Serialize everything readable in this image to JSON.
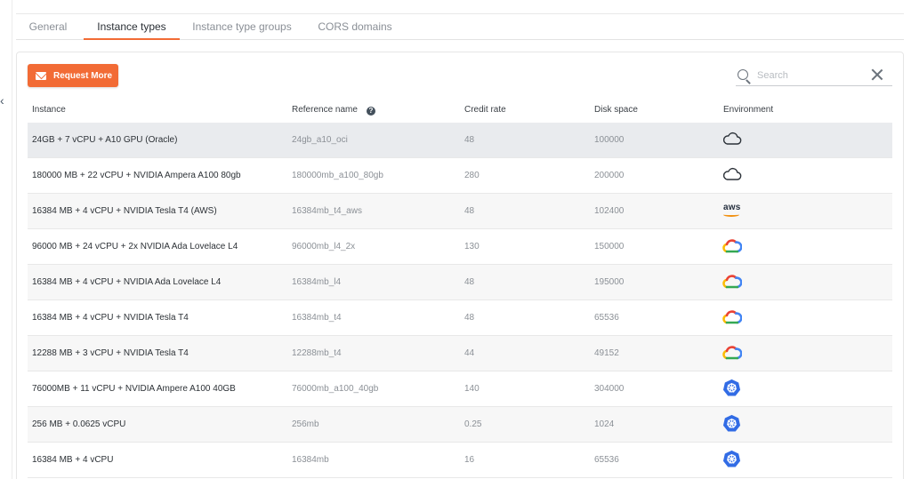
{
  "tabs": [
    {
      "label": "General"
    },
    {
      "label": "Instance types"
    },
    {
      "label": "Instance type groups"
    },
    {
      "label": "CORS domains"
    }
  ],
  "toolbar": {
    "request_label": "Request More",
    "search_placeholder": "Search"
  },
  "table": {
    "headers": {
      "instance": "Instance",
      "reference": "Reference name",
      "credit": "Credit rate",
      "disk": "Disk space",
      "environment": "Environment"
    },
    "rows": [
      {
        "instance": "24GB + 7 vCPU + A10 GPU (Oracle)",
        "reference": "24gb_a10_oci",
        "credit": "48",
        "disk": "100000",
        "env": "cloud-icon"
      },
      {
        "instance": "180000 MB + 22 vCPU + NVIDIA Ampera A100 80gb",
        "reference": "180000mb_a100_80gb",
        "credit": "280",
        "disk": "200000",
        "env": "cloud-icon"
      },
      {
        "instance": "16384 MB + 4 vCPU + NVIDIA Tesla T4 (AWS)",
        "reference": "16384mb_t4_aws",
        "credit": "48",
        "disk": "102400",
        "env": "aws-icon"
      },
      {
        "instance": "96000 MB + 24 vCPU + 2x NVIDIA Ada Lovelace L4",
        "reference": "96000mb_l4_2x",
        "credit": "130",
        "disk": "150000",
        "env": "google-cloud-icon"
      },
      {
        "instance": "16384 MB + 4 vCPU + NVIDIA Ada Lovelace L4",
        "reference": "16384mb_l4",
        "credit": "48",
        "disk": "195000",
        "env": "google-cloud-icon"
      },
      {
        "instance": "16384 MB + 4 vCPU + NVIDIA Tesla T4",
        "reference": "16384mb_t4",
        "credit": "48",
        "disk": "65536",
        "env": "google-cloud-icon"
      },
      {
        "instance": "12288 MB + 3 vCPU + NVIDIA Tesla T4",
        "reference": "12288mb_t4",
        "credit": "44",
        "disk": "49152",
        "env": "google-cloud-icon"
      },
      {
        "instance": "76000MB + 11 vCPU + NVIDIA Ampere A100 40GB",
        "reference": "76000mb_a100_40gb",
        "credit": "140",
        "disk": "304000",
        "env": "kubernetes-icon"
      },
      {
        "instance": "256 MB + 0.0625 vCPU",
        "reference": "256mb",
        "credit": "0.25",
        "disk": "1024",
        "env": "kubernetes-icon"
      },
      {
        "instance": "16384 MB + 4 vCPU",
        "reference": "16384mb",
        "credit": "16",
        "disk": "65536",
        "env": "kubernetes-icon"
      }
    ]
  },
  "colors": {
    "accent": "#f26b35",
    "gcp_blue": "#4285f4",
    "gcp_red": "#ea4335",
    "gcp_yellow": "#fbbc05",
    "gcp_green": "#34a853",
    "kubernetes": "#326ce5",
    "aws_orange": "#f29111"
  },
  "aws_logo_text": "aws"
}
